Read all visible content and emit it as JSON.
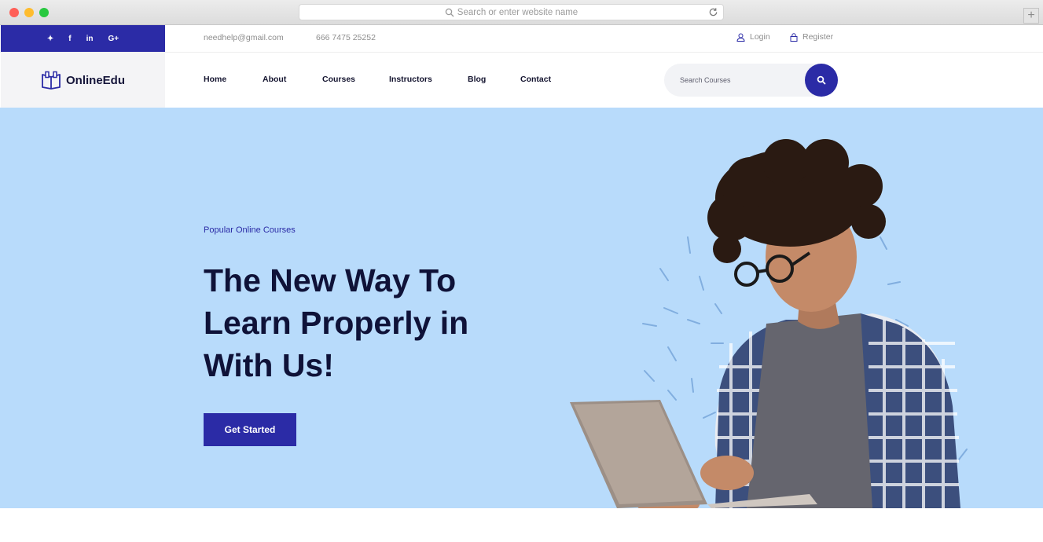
{
  "browser": {
    "address_placeholder": "Search or enter website name"
  },
  "topbar": {
    "social": [
      {
        "icon": "twitter-icon",
        "glyph": "✦"
      },
      {
        "icon": "facebook-icon",
        "glyph": "f"
      },
      {
        "icon": "linkedin-icon",
        "glyph": "in"
      },
      {
        "icon": "google-plus-icon",
        "glyph": "G+"
      }
    ],
    "email": "needhelp@gmail.com",
    "phone": "666 7475 25252",
    "login_label": "Login",
    "register_label": "Register"
  },
  "nav": {
    "logo_text": "OnlineEdu",
    "items": [
      "Home",
      "About",
      "Courses",
      "Instructors",
      "Blog",
      "Contact"
    ],
    "search_placeholder": "Search Courses"
  },
  "hero": {
    "eyebrow": "Popular Online Courses",
    "headline_line1": "The New Way To",
    "headline_line2": "Learn Properly in",
    "headline_line3": "With Us!",
    "cta_label": "Get Started"
  },
  "colors": {
    "brand": "#2b2ba6",
    "hero_bg": "#b8dbfb",
    "heading": "#0f1238"
  }
}
